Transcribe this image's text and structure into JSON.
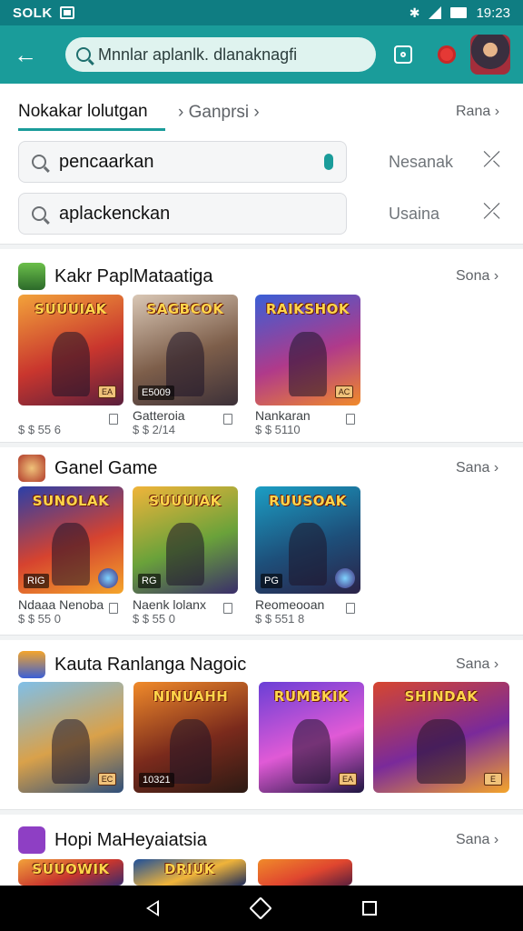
{
  "status": {
    "left_text": "SOLK",
    "time": "19:23"
  },
  "search": {
    "query": "Mnnlar aplanlk. dlanaknagfi"
  },
  "tabs": {
    "active": "Nokakar lolutgan",
    "sub": "Ganprsi",
    "right": "Rana"
  },
  "filters": [
    {
      "query": "pencaarkan",
      "label": "Nesanak"
    },
    {
      "query": "aplackenckan",
      "label": "Usaina"
    }
  ],
  "sections": [
    {
      "title": "Kakr PaplMataatiga",
      "more": "Sona",
      "items": [
        {
          "banner": "SUUUIAK",
          "tag": "EA",
          "caption": "",
          "price": "$ $ 55 6",
          "colors": [
            "#f2a23a",
            "#c9362e",
            "#5a1f3c"
          ]
        },
        {
          "banner": "SAGBCOK",
          "tag": "",
          "ltag": "E5009",
          "caption": "Gatteroia",
          "price": "$ $ 2/14",
          "colors": [
            "#d9c7b5",
            "#7d5e4a",
            "#3c3038"
          ]
        },
        {
          "banner": "RAIKSHOK",
          "tag": "AC",
          "caption": "Nankaran",
          "price": "$ $ 5110",
          "colors": [
            "#3a5fd6",
            "#b03a8a",
            "#f08a2a"
          ]
        }
      ]
    },
    {
      "title": "Ganel Game",
      "more": "Sana",
      "items": [
        {
          "banner": "SUNOLAK",
          "ltag": "RIG",
          "caption": "Ndaaa Nenoba",
          "price": "$ $ 55 0",
          "colors": [
            "#2b3fa8",
            "#d6432f",
            "#f4a52b"
          ],
          "round": true
        },
        {
          "banner": "SUUUIAK",
          "ltag": "RG",
          "caption": "Naenk lolanx",
          "price": "$ $ 55 0",
          "colors": [
            "#f0b43a",
            "#6aa23a",
            "#3a2e6a"
          ]
        },
        {
          "banner": "RUUSOAK",
          "ltag": "PG",
          "caption": "Reomeooan",
          "price": "$ $ 551 8",
          "colors": [
            "#1c9ec4",
            "#1d4f7a",
            "#2b2348"
          ],
          "round": true
        }
      ]
    },
    {
      "title": "Kauta Ranlanga Nagoic",
      "more": "Sana",
      "items": [
        {
          "banner": "",
          "tag": "EC",
          "colors": [
            "#7fbfe8",
            "#d9a14a",
            "#2f4f7a"
          ]
        },
        {
          "banner": "NINUAHH",
          "ltag": "10321",
          "colors": [
            "#f08a2a",
            "#7a2a1c",
            "#2c1a14"
          ]
        },
        {
          "banner": "RUMBKIK",
          "tag": "EA",
          "colors": [
            "#6a3fd6",
            "#e05ad6",
            "#1e1640"
          ]
        },
        {
          "banner": "SHINDAK",
          "tag": "E",
          "colors": [
            "#d6462f",
            "#7a2a9a",
            "#f4a52b"
          ]
        }
      ]
    },
    {
      "title": "Hopi MaHeyaiatsia",
      "more": "Sana",
      "items": [
        {
          "banner": "SUUOWIK",
          "colors": [
            "#f2a23a",
            "#c9362e",
            "#3a2a6a"
          ]
        },
        {
          "banner": "DRIUK",
          "colors": [
            "#1d4f9a",
            "#f0b43a",
            "#1b2a5a"
          ]
        },
        {
          "banner": "",
          "colors": [
            "#f08a2a",
            "#e0462f",
            "#5a1f3c"
          ]
        }
      ]
    }
  ]
}
